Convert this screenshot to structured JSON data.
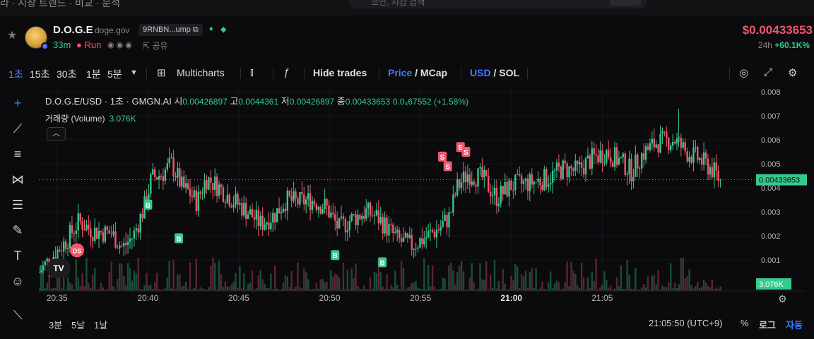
{
  "top": {
    "crumb": "라 · 시장 트렌드 · 비교 · 분석",
    "search_placeholder": "코인, 지갑 검색"
  },
  "token": {
    "name": "D.O.G.E",
    "domain": "doge.gov",
    "address": "9RNBN...ump",
    "age": "33m",
    "status": "Run",
    "share_label": "공유",
    "price": "$0.00433653",
    "change_period": "24h",
    "change_value": "+60.1K%"
  },
  "toolbar": {
    "timeframes": [
      "1초",
      "15초",
      "30초",
      "1분",
      "5분"
    ],
    "multicharts": "Multicharts",
    "hide_trades": "Hide trades",
    "price": "Price",
    "mcap": "MCap",
    "usd": "USD",
    "sol": "SOL"
  },
  "legend": {
    "title": "D.O.G.E/USD · 1초 · GMGN.AI",
    "open_label": "시",
    "open": "0.00426897",
    "high_label": "고",
    "high": "0.0044361",
    "low_label": "저",
    "low": "0.00426897",
    "close_label": "종",
    "close": "0.00433653",
    "delta": "0.0₄67552 (+1.58%)",
    "volume_label": "거래량 (Volume)",
    "volume_value": "3.076K"
  },
  "chart_data": {
    "type": "candlestick",
    "x_ticks": [
      "20:35",
      "20:40",
      "20:45",
      "20:50",
      "20:55",
      "21:00",
      "21:05"
    ],
    "y_ticks": [
      "0.008",
      "0.007",
      "0.006",
      "0.005",
      "0.004",
      "0.003",
      "0.002",
      "0.001"
    ],
    "ylim": [
      0.0,
      0.0085
    ],
    "current_price_label": "0.00433653",
    "volume_label": "3.076K",
    "price_path": [
      [
        0,
        0.0005
      ],
      [
        1.5,
        0.0018
      ],
      [
        2.2,
        0.0026
      ],
      [
        3,
        0.0022
      ],
      [
        4,
        0.0021
      ],
      [
        4.6,
        0.0015
      ],
      [
        5.2,
        0.002
      ],
      [
        5.8,
        0.0032
      ],
      [
        6.2,
        0.0044
      ],
      [
        6.8,
        0.0046
      ],
      [
        7.3,
        0.005
      ],
      [
        7.9,
        0.004
      ],
      [
        8.3,
        0.0038
      ],
      [
        8.7,
        0.0034
      ],
      [
        9.2,
        0.0044
      ],
      [
        9.8,
        0.0041
      ],
      [
        10.5,
        0.0036
      ],
      [
        11.5,
        0.003
      ],
      [
        12.2,
        0.0025
      ],
      [
        13,
        0.0029
      ],
      [
        13.6,
        0.0035
      ],
      [
        14.2,
        0.0034
      ],
      [
        15,
        0.0035
      ],
      [
        15.8,
        0.0032
      ],
      [
        16.5,
        0.0023
      ],
      [
        17.2,
        0.0027
      ],
      [
        18,
        0.003
      ],
      [
        18.6,
        0.0028
      ],
      [
        19.2,
        0.0023
      ],
      [
        19.8,
        0.0018
      ],
      [
        20.5,
        0.0016
      ],
      [
        21.2,
        0.0019
      ],
      [
        22,
        0.0023
      ],
      [
        22.6,
        0.0028
      ],
      [
        23,
        0.004
      ],
      [
        23.6,
        0.0046
      ],
      [
        24.4,
        0.0044
      ],
      [
        25.2,
        0.0036
      ],
      [
        26,
        0.0041
      ],
      [
        27,
        0.0042
      ],
      [
        28,
        0.0044
      ],
      [
        28.8,
        0.0048
      ],
      [
        29.6,
        0.0047
      ],
      [
        30.4,
        0.0052
      ],
      [
        31.2,
        0.0055
      ],
      [
        32,
        0.0051
      ],
      [
        32.6,
        0.0047
      ],
      [
        33.2,
        0.0054
      ],
      [
        34,
        0.0059
      ],
      [
        35,
        0.006
      ],
      [
        35.6,
        0.0055
      ],
      [
        36.3,
        0.0052
      ],
      [
        37,
        0.0048
      ],
      [
        37.5,
        0.0043
      ]
    ],
    "trade_markers": [
      {
        "label": "DS",
        "t": 2.1,
        "v": 0.0014,
        "side": "sell"
      },
      {
        "label": "B",
        "t": 6.0,
        "v": 0.0033,
        "side": "buy"
      },
      {
        "label": "B",
        "t": 7.7,
        "v": 0.0019,
        "side": "buy"
      },
      {
        "label": "B",
        "t": 16.3,
        "v": 0.0012,
        "side": "buy"
      },
      {
        "label": "B",
        "t": 18.9,
        "v": 0.0009,
        "side": "buy"
      },
      {
        "label": "S",
        "t": 22.2,
        "v": 0.0053,
        "side": "sell"
      },
      {
        "label": "S",
        "t": 22.5,
        "v": 0.0049,
        "side": "sell"
      },
      {
        "label": "S",
        "t": 23.2,
        "v": 0.0057,
        "side": "sell"
      },
      {
        "label": "S",
        "t": 23.5,
        "v": 0.0055,
        "side": "sell"
      }
    ]
  },
  "bottom": {
    "ranges": [
      "3분",
      "5날",
      "1날"
    ],
    "time": "21:05:50 (UTC+9)",
    "percent": "%",
    "log": "로그",
    "auto": "자동"
  },
  "colors": {
    "up": "#35c98e",
    "down": "#f0566c",
    "accent": "#3d7bff",
    "bg": "#0b0b0d"
  }
}
